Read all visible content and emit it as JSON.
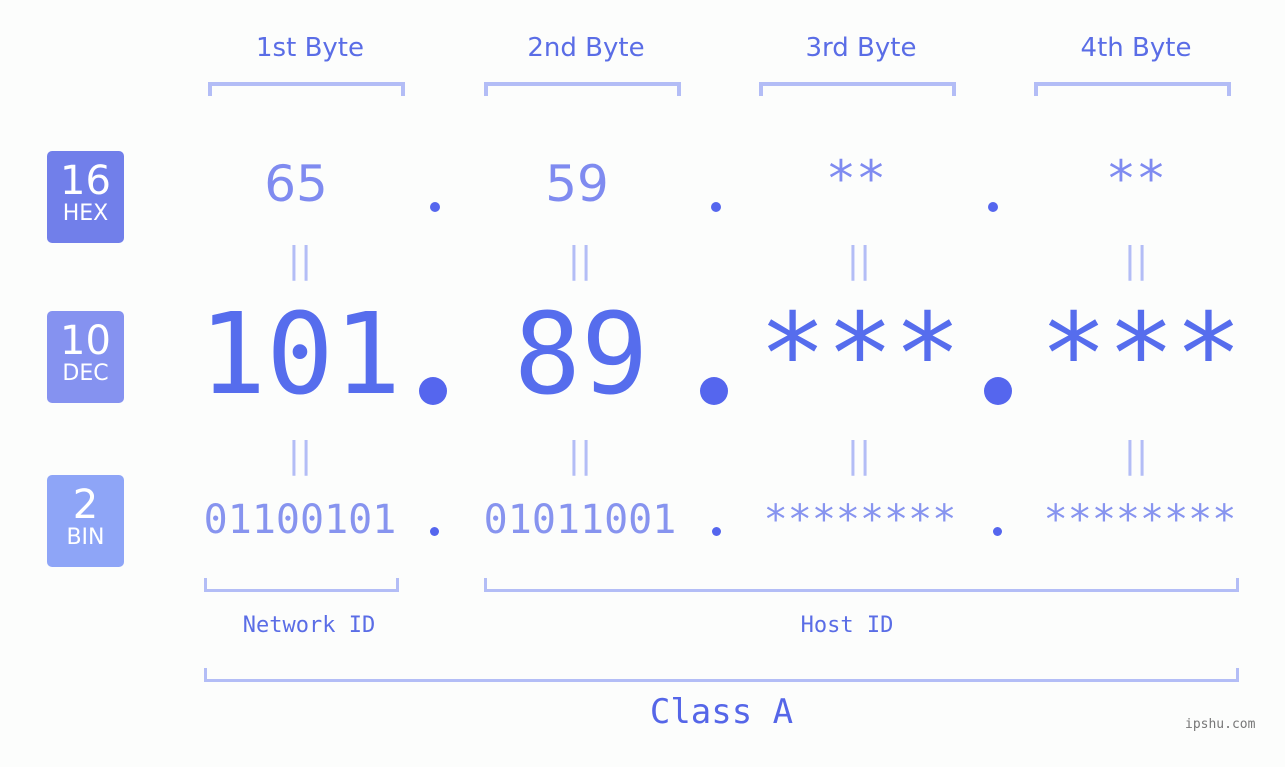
{
  "bytes": [
    {
      "label": "1st Byte",
      "hex": "65",
      "dec": "101",
      "bin": "01100101"
    },
    {
      "label": "2nd Byte",
      "hex": "59",
      "dec": "89",
      "bin": "01011001"
    },
    {
      "label": "3rd Byte",
      "hex": "**",
      "dec": "***",
      "bin": "********"
    },
    {
      "label": "4th Byte",
      "hex": "**",
      "dec": "***",
      "bin": "********"
    }
  ],
  "badges": {
    "hex": {
      "num": "16",
      "label": "HEX",
      "color": "#717fea"
    },
    "dec": {
      "num": "10",
      "label": "DEC",
      "color": "#8592f0"
    },
    "bin": {
      "num": "2",
      "label": "BIN",
      "color": "#8ea5f7"
    }
  },
  "equals_sign": "||",
  "separator": ".",
  "network_id_label": "Network ID",
  "host_id_label": "Host ID",
  "class_label": "Class A",
  "watermark": "ipshu.com"
}
